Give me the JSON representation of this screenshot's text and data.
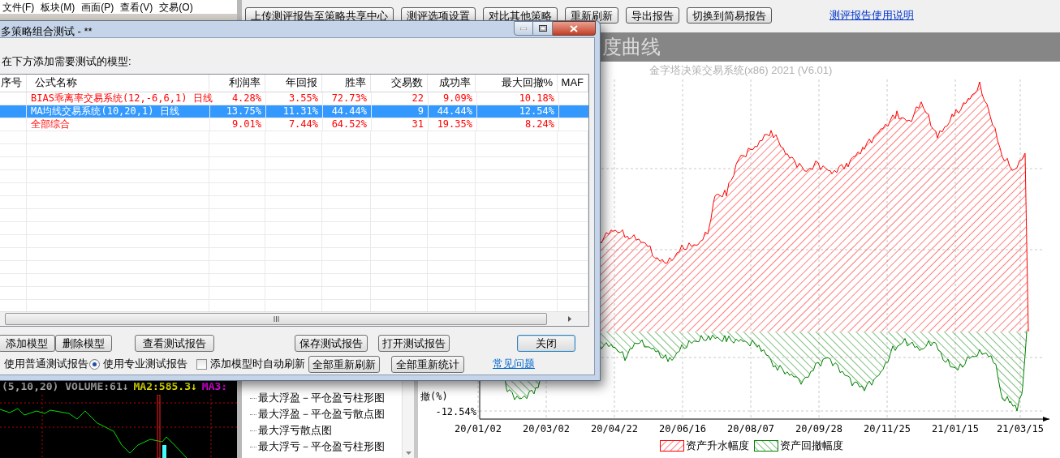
{
  "menu_bar": [
    "文件(F)",
    "板块(M)",
    "画面(P)",
    "查看(V)",
    "交易(O)"
  ],
  "report_toolbar": {
    "buttons": [
      "上传测评报告至策略共享中心",
      "测评选项设置",
      "对比其他策略",
      "重新刷新",
      "导出报告",
      "切换到简易报告"
    ],
    "link": "测评报告使用说明"
  },
  "report_title": "度曲线",
  "chart": {
    "subtitle": "金字塔决策交易系统(x86) 2021 (V6.01)",
    "y_label": "撤(%)",
    "y_tick": "-12.54%",
    "x_ticks": [
      "20/01/02",
      "20/03/02",
      "20/04/22",
      "20/06/16",
      "20/08/07",
      "20/09/28",
      "20/11/25",
      "21/01/15",
      "21/03/15"
    ],
    "legend": [
      {
        "label": "资产升水幅度",
        "color": "#ff0000"
      },
      {
        "label": "资产回撤幅度",
        "color": "#008000"
      }
    ]
  },
  "tree": {
    "items": [
      "最大浮盈－平仓盈亏柱形图",
      "最大浮盈－平仓盈亏散点图",
      "最大浮亏散点图",
      "最大浮亏－平仓盈亏柱形图"
    ]
  },
  "price_chart": {
    "indicators": [
      {
        "text": "(5,10,20) VOLUME:61↓",
        "kind": "volume"
      },
      {
        "text": "MA2:585.3↓",
        "kind": "ma2"
      },
      {
        "text": "MA3:",
        "kind": "ma3"
      }
    ]
  },
  "dialog": {
    "title": "多策略组合测试 - **",
    "prompt": "在下方添加需要测试的模型:",
    "table": {
      "columns": [
        "序号",
        "公式名称",
        "利润率",
        "年回报",
        "胜率",
        "交易数",
        "成功率",
        "最大回撤%",
        "MAF"
      ],
      "rows": [
        {
          "cells": [
            "",
            "BIAS乖离率交易系统(12,-6,6,1) 日线",
            "4.28%",
            "3.55%",
            "72.73%",
            "22",
            "9.09%",
            "10.18%"
          ],
          "selected": false
        },
        {
          "cells": [
            "",
            "MA均线交易系统(10,20,1) 日线",
            "13.75%",
            "11.31%",
            "44.44%",
            "9",
            "44.44%",
            "12.54%"
          ],
          "selected": true
        },
        {
          "cells": [
            "",
            "全部综合",
            "9.01%",
            "7.44%",
            "64.52%",
            "31",
            "19.35%",
            "8.24%"
          ],
          "selected": false
        }
      ]
    },
    "buttons_row1": [
      {
        "label": "添加模型",
        "default": false
      },
      {
        "label": "删除模型",
        "default": false
      },
      {
        "label": "查看测试报告",
        "default": false
      },
      {
        "label": "保存测试报告",
        "default": false
      },
      {
        "label": "打开测试报告",
        "default": false
      },
      {
        "label": "关闭",
        "default": true
      }
    ],
    "radio_options": [
      {
        "label": "使用普通测试报告"
      },
      {
        "label": "使用专业测试报告",
        "selected": true
      }
    ],
    "auto_refresh": {
      "label": "添加模型时自动刷新",
      "checked": false
    },
    "buttons_row2": [
      "全部重新刷新",
      "全部重新统计"
    ],
    "help_link": "常见问题"
  }
}
